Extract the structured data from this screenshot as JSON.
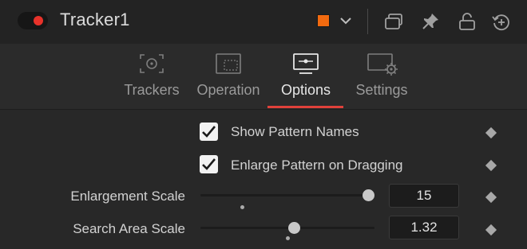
{
  "header": {
    "title": "Tracker1",
    "enabled": true,
    "toggle_color": "#e8322a",
    "color_swatch": "#f26a0f",
    "icons": [
      "color-dropdown-chevron-icon",
      "versions-icon",
      "pin-icon",
      "lock-icon",
      "reset-icon"
    ]
  },
  "tabs": [
    {
      "label": "Trackers",
      "icon": "trackers-icon",
      "active": false
    },
    {
      "label": "Operation",
      "icon": "operation-icon",
      "active": false
    },
    {
      "label": "Options",
      "icon": "options-icon",
      "active": true
    },
    {
      "label": "Settings",
      "icon": "settings-icon",
      "active": false
    }
  ],
  "options": {
    "show_pattern_names": {
      "label": "Show Pattern Names",
      "checked": true
    },
    "enlarge_pattern": {
      "label": "Enlarge Pattern on Dragging",
      "checked": true
    },
    "enlargement_scale": {
      "label": "Enlargement Scale",
      "value": "15",
      "level": 1.0,
      "default_level": 0.24
    },
    "search_area_scale": {
      "label": "Search Area Scale",
      "value": "1.32",
      "level": 0.54,
      "default_level": 0.5
    }
  }
}
